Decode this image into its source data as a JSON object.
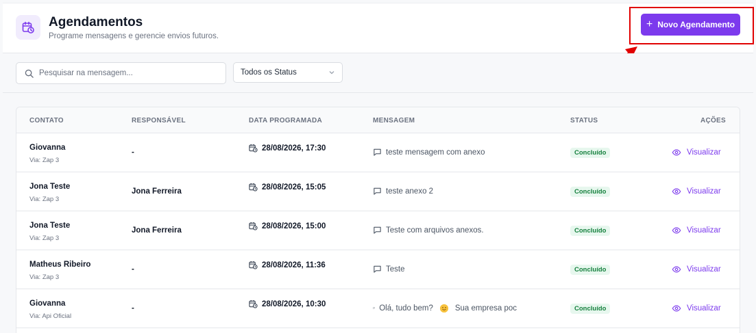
{
  "header": {
    "title": "Agendamentos",
    "subtitle": "Programe mensagens e gerencie envios futuros.",
    "new_button_label": "Novo Agendamento",
    "icon": "calendar-clock-icon"
  },
  "filters": {
    "search_placeholder": "Pesquisar na mensagem...",
    "status_selected": "Todos os Status"
  },
  "table": {
    "columns": [
      "CONTATO",
      "RESPONSÁVEL",
      "DATA PROGRAMADA",
      "MENSAGEM",
      "STATUS",
      "AÇÕES"
    ],
    "rows": [
      {
        "contact": "Giovanna",
        "via": "Via: Zap 3",
        "responsible": "-",
        "date": "28/08/2026, 17:30",
        "message": "teste mensagem com anexo",
        "status": "Concluído",
        "action": "Visualizar"
      },
      {
        "contact": "Jona Teste",
        "via": "Via: Zap 3",
        "responsible": "Jona Ferreira",
        "date": "28/08/2026, 15:05",
        "message": "teste anexo 2",
        "status": "Concluído",
        "action": "Visualizar"
      },
      {
        "contact": "Jona Teste",
        "via": "Via: Zap 3",
        "responsible": "Jona Ferreira",
        "date": "28/08/2026, 15:00",
        "message": "Teste com arquivos anexos.",
        "status": "Concluído",
        "action": "Visualizar"
      },
      {
        "contact": "Matheus Ribeiro",
        "via": "Via: Zap 3",
        "responsible": "-",
        "date": "28/08/2026, 11:36",
        "message": "Teste",
        "status": "Concluído",
        "action": "Visualizar"
      },
      {
        "contact": "Giovanna",
        "via": "Via: Api Oficial",
        "responsible": "-",
        "date": "28/08/2026, 10:30",
        "message": "Olá, tudo bem?",
        "message_rest": "Sua empresa poc",
        "status": "Concluído",
        "action": "Visualizar"
      }
    ]
  },
  "colors": {
    "accent": "#7c3aed",
    "success_bg": "#e7f7ee",
    "success_text": "#15803d",
    "annotation": "#e10000"
  }
}
